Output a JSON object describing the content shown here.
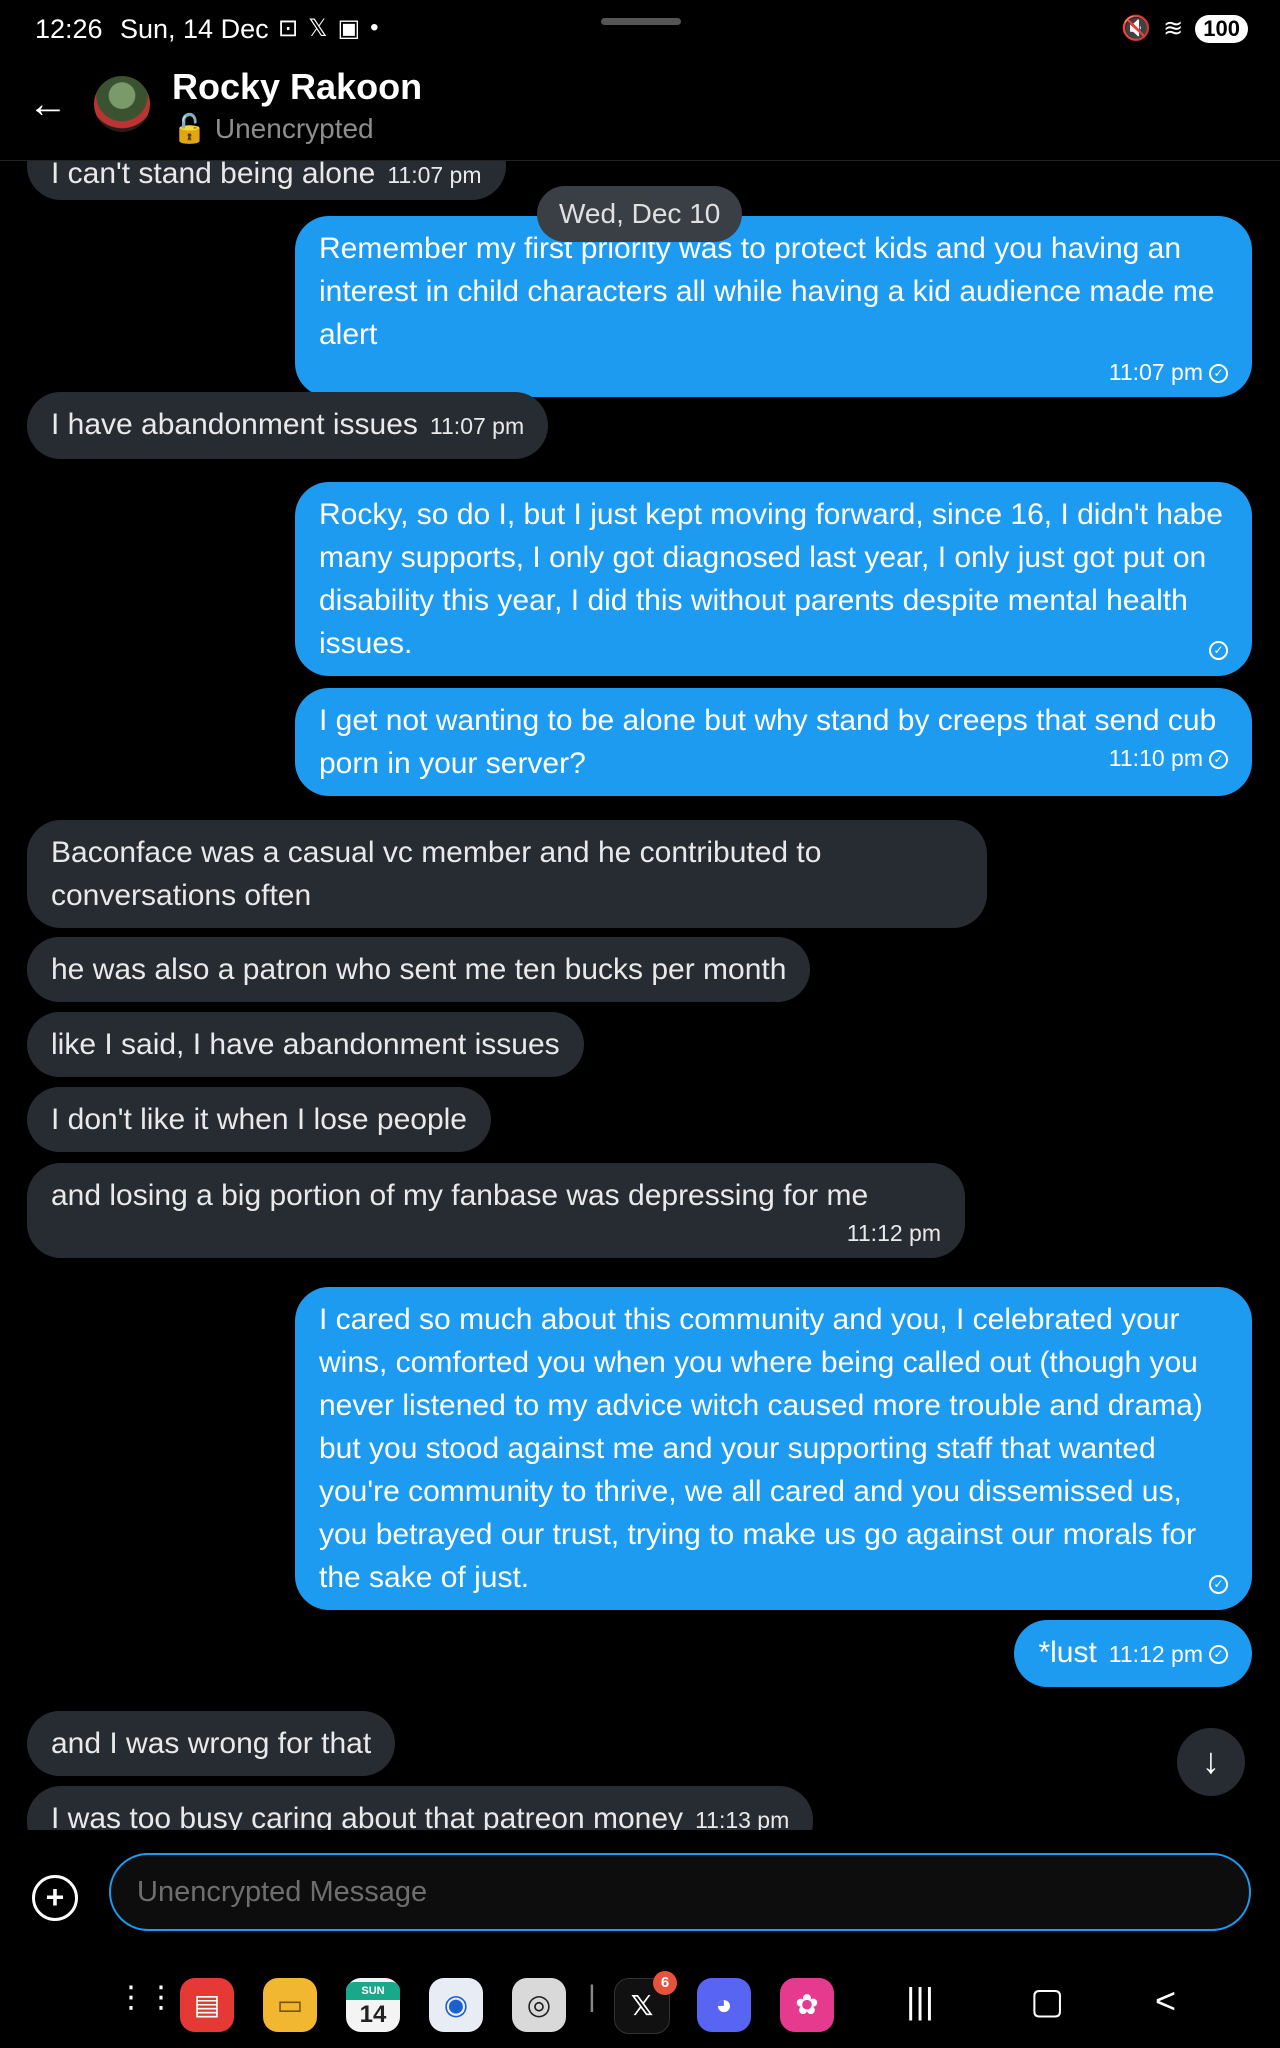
{
  "status_bar": {
    "time": "12:26",
    "date": "Sun, 14 Dec",
    "battery": "100"
  },
  "header": {
    "contact_name": "Rocky Rakoon",
    "contact_status": "Unencrypted"
  },
  "date_separator": "Wed, Dec 10",
  "messages": [
    {
      "dir": "in",
      "text": "I can't stand being alone",
      "time": "11:07 pm"
    },
    {
      "dir": "out",
      "text": "Remember my first priority was to protect kids and you having an interest in child characters all while having a kid audience made me alert",
      "time": "11:07 pm"
    },
    {
      "dir": "in",
      "text": "I have abandonment issues",
      "time": "11:07 pm"
    },
    {
      "dir": "out",
      "text": "Rocky, so do I, but I just kept moving forward, since 16, I didn't habe many supports, I only got diagnosed last year, I only just got put on disability this year, I did this without parents despite mental health issues.",
      "time": ""
    },
    {
      "dir": "out",
      "text": "I get not wanting to be alone but why stand by creeps that send cub porn in your server?",
      "time": "11:10 pm"
    },
    {
      "dir": "in",
      "text": "Baconface was a casual vc member and he contributed to conversations often",
      "time": ""
    },
    {
      "dir": "in",
      "text": "he was also a patron who sent me ten bucks per month",
      "time": ""
    },
    {
      "dir": "in",
      "text": "like I said, I have abandonment issues",
      "time": ""
    },
    {
      "dir": "in",
      "text": "I don't like it when I lose people",
      "time": ""
    },
    {
      "dir": "in",
      "text": "and losing a big portion of my fanbase was depressing for me",
      "time": "11:12 pm"
    },
    {
      "dir": "out",
      "text": "I cared so much about this community and you, I celebrated your wins, comforted you when you where being called out (though you never listened to my advice witch caused more trouble and drama) but you stood against me and your supporting staff that wanted you're community to thrive, we all cared and you dissemissed us, you betrayed our trust, trying to make us go against our morals for the sake of just.",
      "time": ""
    },
    {
      "dir": "out",
      "text": "*lust",
      "time": "11:12 pm"
    },
    {
      "dir": "in",
      "text": "and I was wrong for that",
      "time": ""
    },
    {
      "dir": "in",
      "text": "I was too busy caring about that patreon money",
      "time": "11:13 pm"
    }
  ],
  "composer": {
    "placeholder": "Unencrypted Message"
  },
  "dock": {
    "calendar_day": "SUN",
    "calendar_date": "14",
    "x_badge": "6"
  }
}
